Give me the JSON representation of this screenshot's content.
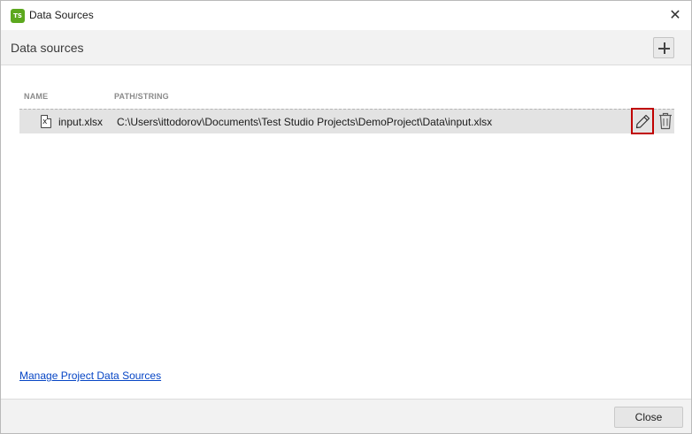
{
  "window": {
    "title": "Data Sources",
    "logo_text": "TS",
    "close_glyph": "✕"
  },
  "header": {
    "title": "Data sources",
    "add_icon": "plus-icon"
  },
  "table": {
    "columns": [
      "NAME",
      "PATH/STRING"
    ],
    "rows": [
      {
        "name": "input.xlsx",
        "path": "C:\\Users\\ittodorov\\Documents\\Test Studio Projects\\DemoProject\\Data\\input.xlsx",
        "icon": "excel-file-icon"
      }
    ],
    "row_actions": [
      "pencil-icon",
      "trash-icon"
    ]
  },
  "footer": {
    "manage_link": "Manage Project Data Sources",
    "close_button": "Close"
  },
  "colors": {
    "logo": "#5ca81e",
    "highlight": "#c00000",
    "link": "#0645c5"
  }
}
